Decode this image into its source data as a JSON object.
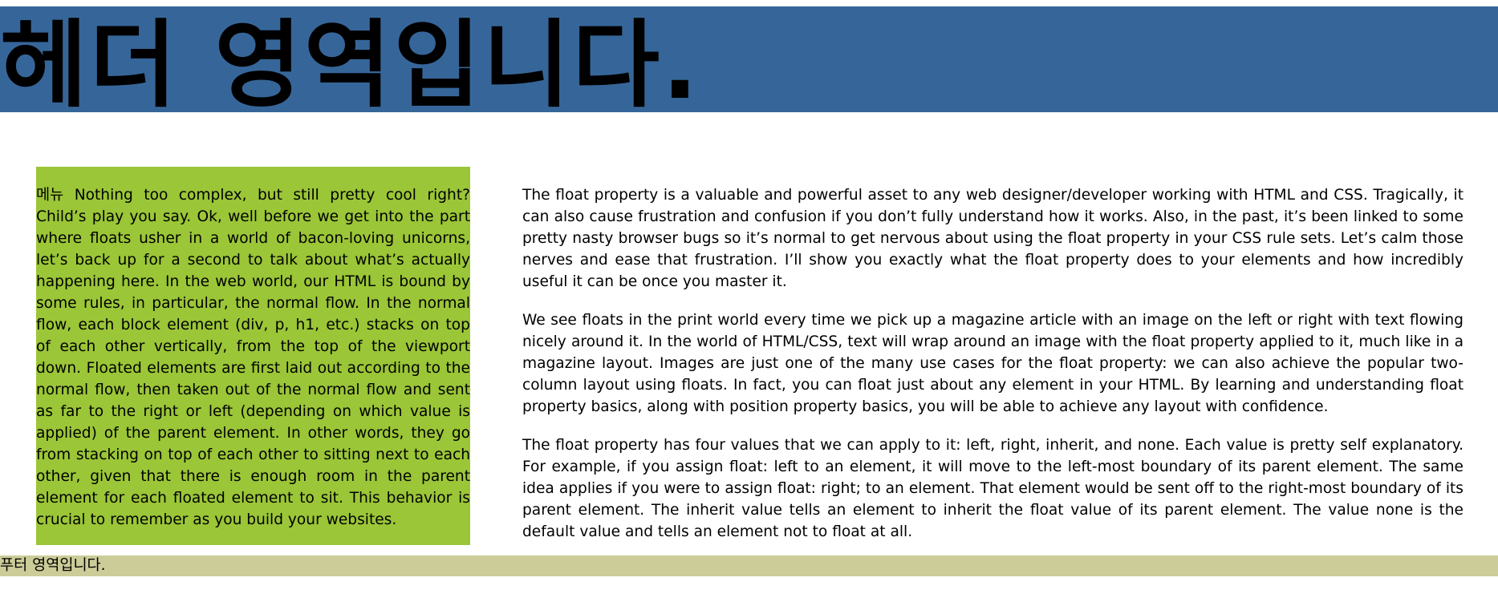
{
  "header": {
    "title": "헤더 영역입니다."
  },
  "menu": {
    "label": "메뉴",
    "text": "Nothing too complex, but still pretty cool right? Child’s play you say. Ok, well before we get into the part where floats usher in a world of bacon-loving unicorns, let’s back up for a second to talk about what’s actually happening here. In the web world, our HTML is bound by some rules, in particular, the normal flow. In the normal flow, each block element (div, p, h1, etc.) stacks on top of each other vertically, from the top of the viewport down. Floated elements are first laid out according to the normal flow, then taken out of the normal flow and sent as far to the right or left (depending on which value is applied) of the parent element. In other words, they go from stacking on top of each other to sitting next to each other, given that there is enough room in the parent element for each floated element to sit. This behavior is crucial to remember as you build your websites."
  },
  "content": {
    "paragraphs": [
      "The float property is a valuable and powerful asset to any web designer/developer working with HTML and CSS. Tragically, it can also cause frustration and confusion if you don’t fully understand how it works. Also, in the past, it’s been linked to some pretty nasty browser bugs so it’s normal to get nervous about using the float property in your CSS rule sets. Let’s calm those nerves and ease that frustration. I’ll show you exactly what the float property does to your elements and how incredibly useful it can be once you master it.",
      "We see floats in the print world every time we pick up a magazine article with an image on the left or right with text flowing nicely around it. In the world of HTML/CSS, text will wrap around an image with the float property applied to it, much like in a magazine layout. Images are just one of the many use cases for the float property: we can also achieve the popular two-column layout using floats. In fact, you can float just about any element in your HTML. By learning and understanding float property basics, along with position property basics, you will be able to achieve any layout with confidence.",
      "The float property has four values that we can apply to it: left, right, inherit, and none. Each value is pretty self explanatory. For example, if you assign float: left to an element, it will move to the left-most boundary of its parent element. The same idea applies if you were to assign float: right; to an element. That element would be sent off to the right-most boundary of its parent element. The inherit value tells an element to inherit the float value of its parent element. The value none is the default value and tells an element not to float at all."
    ]
  },
  "footer": {
    "text": "푸터 영역입니다."
  },
  "colors": {
    "header_bg": "#366699",
    "menu_bg": "#9bc637",
    "footer_bg": "#cccc99"
  }
}
